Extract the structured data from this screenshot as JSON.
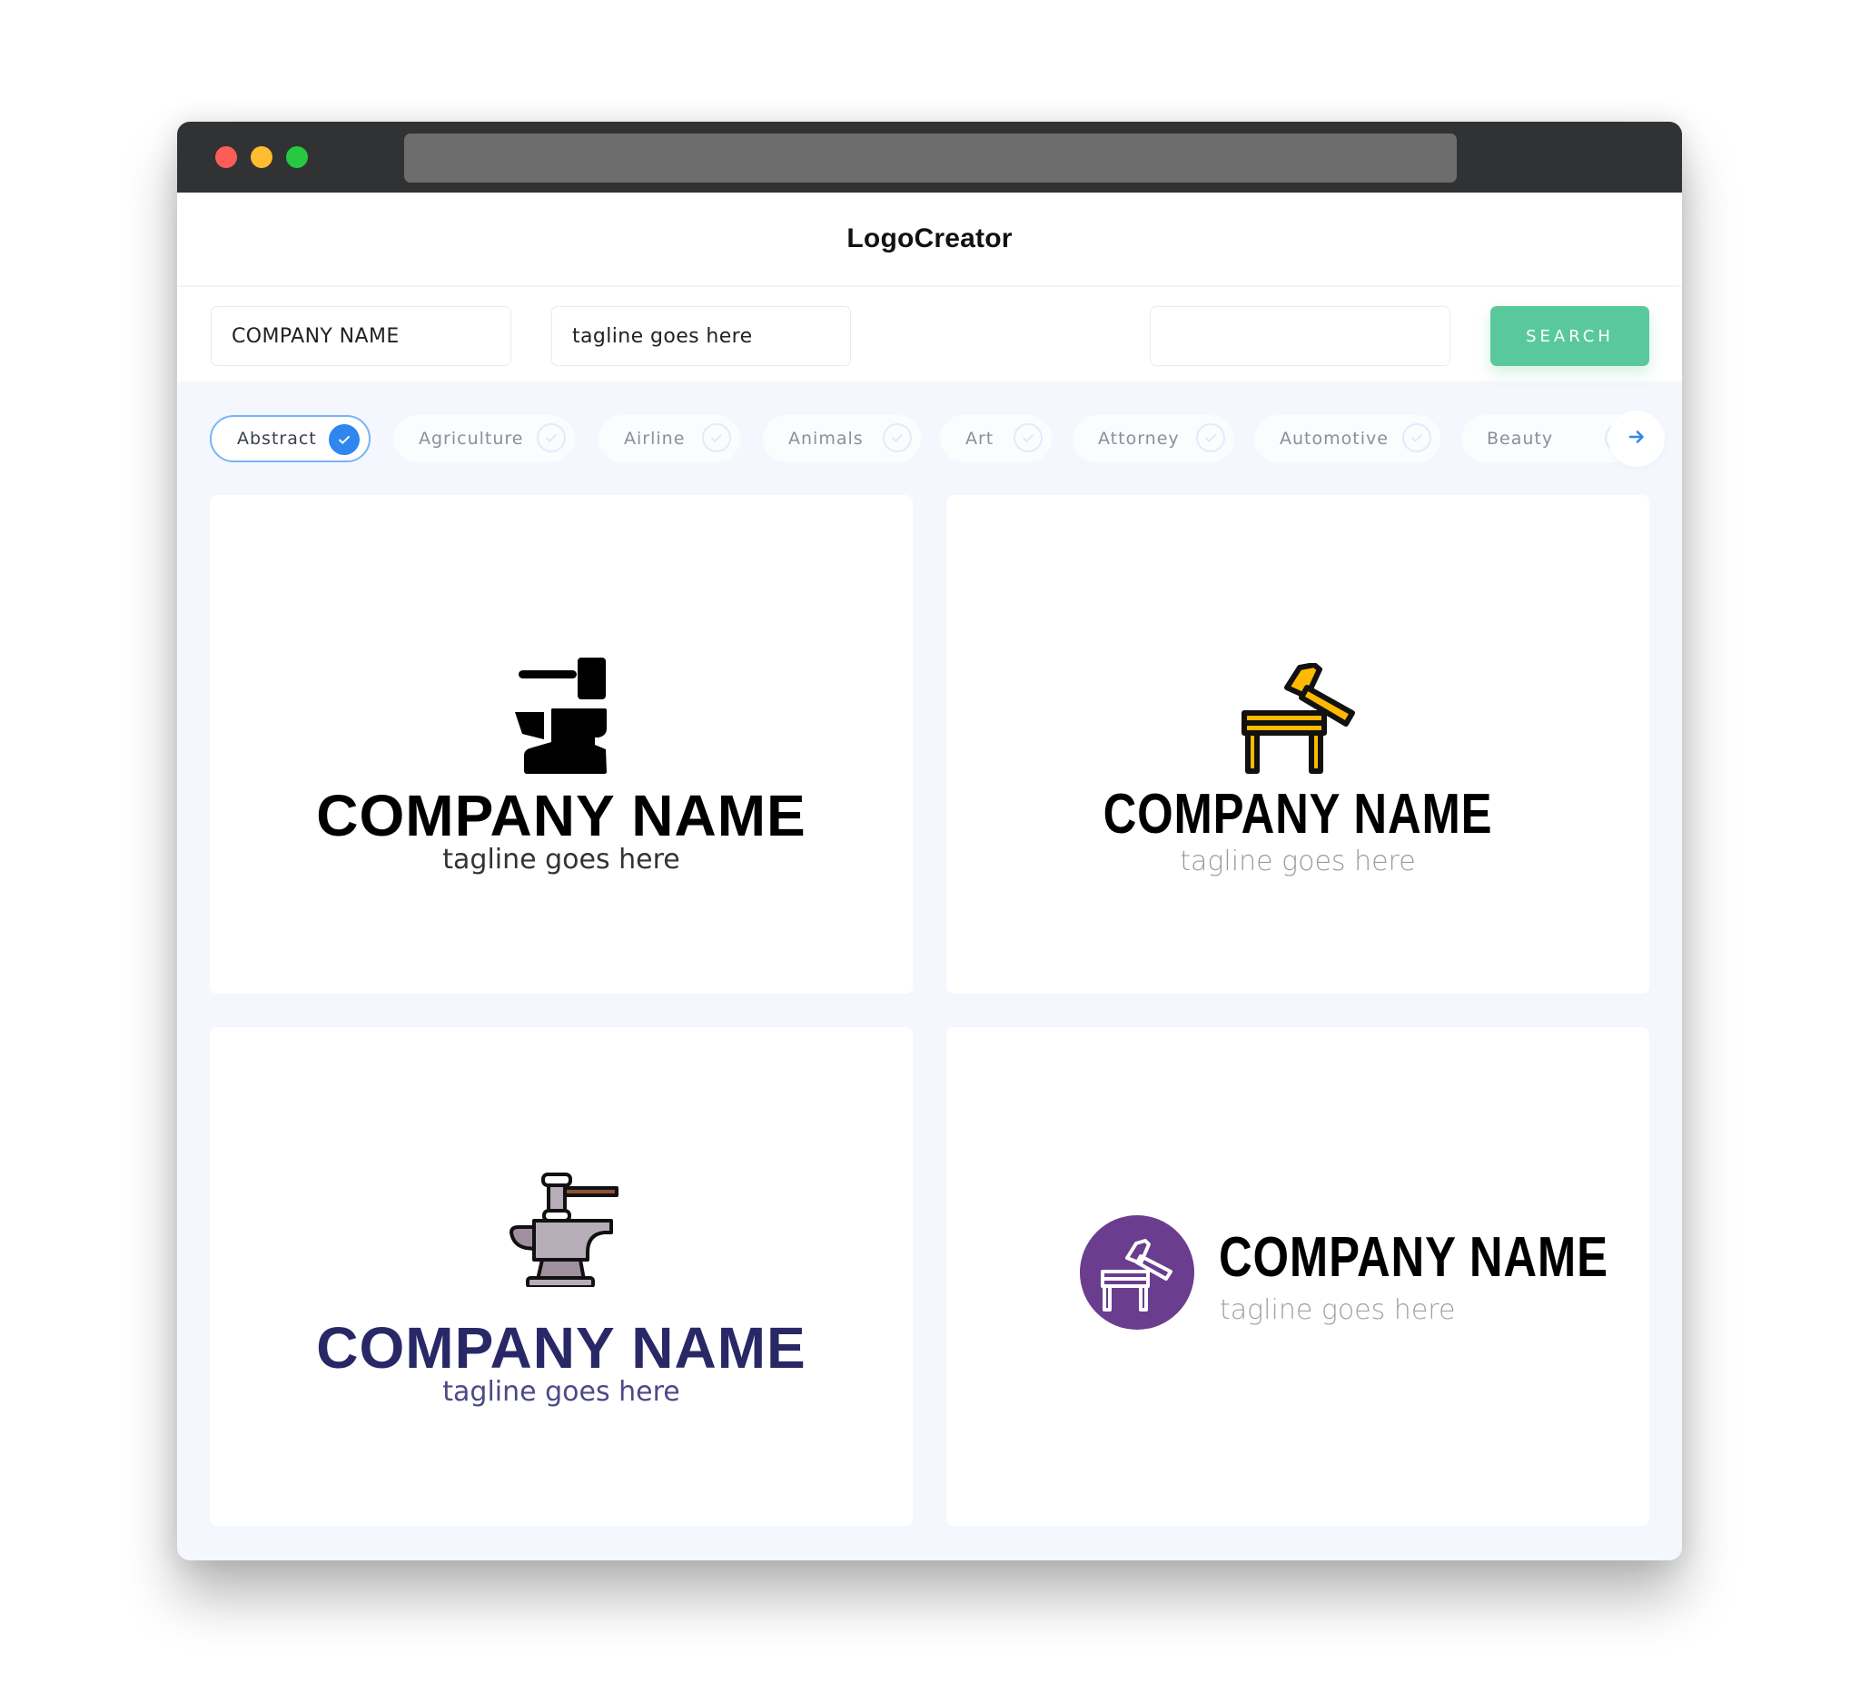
{
  "window": {
    "traffic_lights": [
      "close",
      "minimize",
      "maximize"
    ],
    "url": ""
  },
  "header": {
    "brand": "LogoCreator"
  },
  "search": {
    "company_name_value": "COMPANY NAME",
    "tagline_value": "tagline goes here",
    "keyword_value": "",
    "button_label": "SEARCH"
  },
  "categories": [
    {
      "label": "Abstract",
      "selected": true
    },
    {
      "label": "Agriculture",
      "selected": false
    },
    {
      "label": "Airline",
      "selected": false
    },
    {
      "label": "Animals",
      "selected": false
    },
    {
      "label": "Art",
      "selected": false
    },
    {
      "label": "Attorney",
      "selected": false
    },
    {
      "label": "Automotive",
      "selected": false
    },
    {
      "label": "Beauty",
      "selected": false
    }
  ],
  "next_icon": "arrow-right-icon",
  "colors": {
    "accent_green": "#59c99c",
    "accent_blue": "#2f86ef",
    "titlebar": "#313234",
    "page_bg": "#f4f7fd"
  },
  "logos": [
    {
      "icon": "anvil-hammer-icon",
      "company": "COMPANY NAME",
      "tagline": "tagline goes here",
      "name_color": "#000000",
      "tagline_color": "#333333",
      "icon_color": "#000000"
    },
    {
      "icon": "workbench-hammer-icon",
      "company": "COMPANY NAME",
      "tagline": "tagline goes here",
      "name_color": "#000000",
      "tagline_color": "#9a9a9a",
      "icon_color": "#ffb900"
    },
    {
      "icon": "anvil-press-icon",
      "company": "COMPANY NAME",
      "tagline": "tagline goes here",
      "name_color": "#292866",
      "tagline_color": "#4c4a86",
      "icon_color": "#b7adb9"
    },
    {
      "icon": "workbench-hammer-circle-icon",
      "company": "COMPANY NAME",
      "tagline": "tagline goes here",
      "name_color": "#000000",
      "tagline_color": "#a0a0a0",
      "icon_color": "#6a3d8f"
    }
  ]
}
